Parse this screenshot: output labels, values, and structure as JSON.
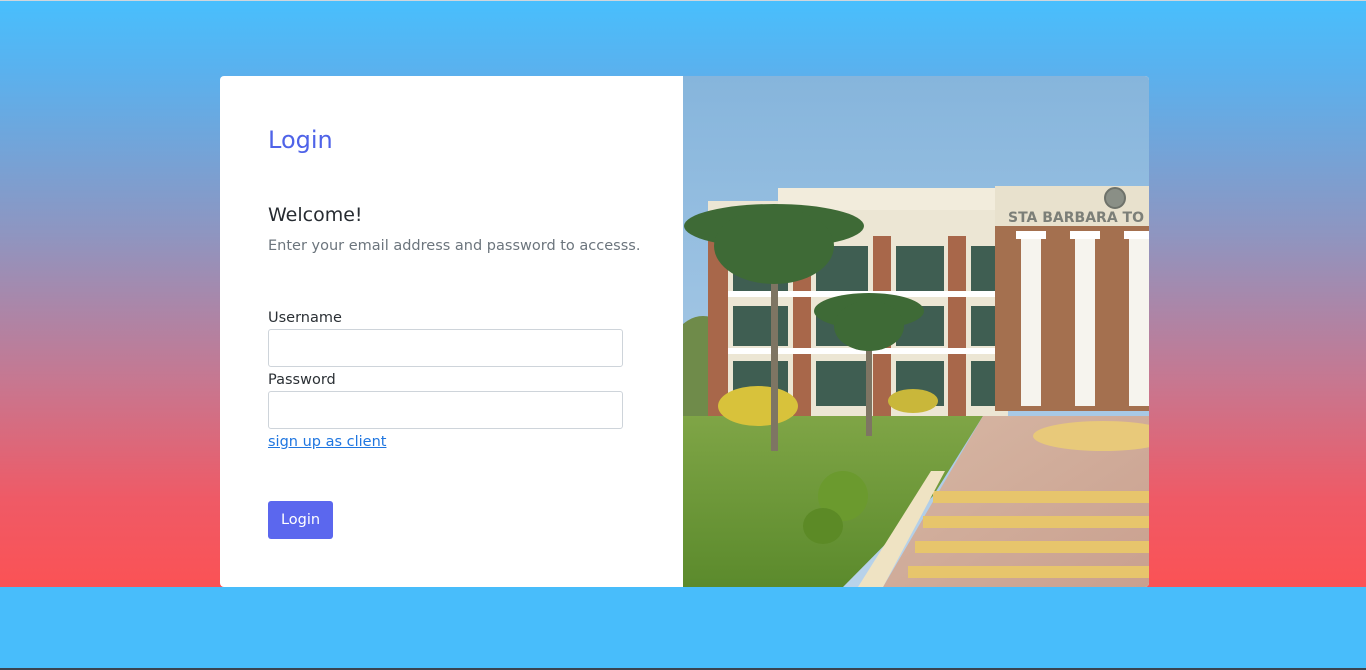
{
  "login_form": {
    "title": "Login",
    "welcome": "Welcome!",
    "subtitle": "Enter your email address and password to accesss.",
    "username_label": "Username",
    "username_value": "",
    "password_label": "Password",
    "password_value": "",
    "signup_link": "sign up as client",
    "login_button": "Login"
  },
  "photo": {
    "building_sign": "STA BARBARA TO"
  },
  "colors": {
    "accent": "#5b67ee",
    "title": "#4f63e8",
    "link": "#1f76e0",
    "background_top": "#48bffd",
    "background_bottom": "#fb5255"
  }
}
